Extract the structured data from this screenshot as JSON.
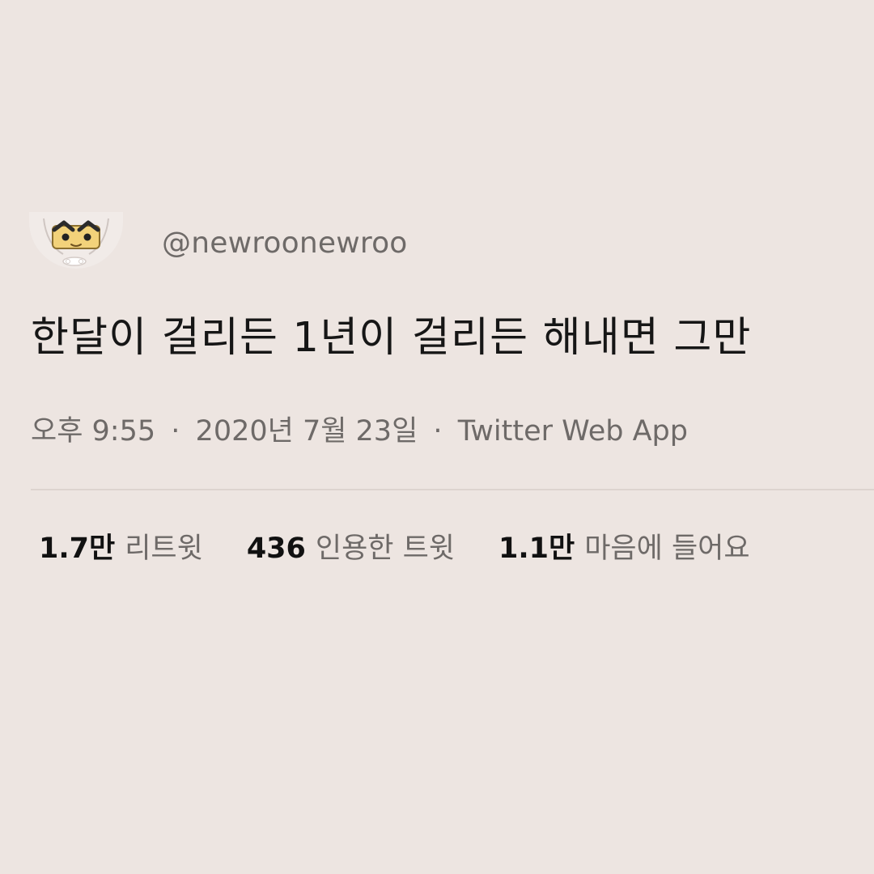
{
  "tweet": {
    "avatar_icon": "cartoon-character-avatar-icon",
    "handle": "@newroonewroo",
    "text": "한달이 걸리든 1년이 걸리든 해내면 그만",
    "time": "오후 9:55",
    "separator": "·",
    "date": "2020년 7월 23일",
    "source": "Twitter Web App",
    "stats": [
      {
        "count": "1.7만",
        "label": "리트윗"
      },
      {
        "count": "436",
        "label": "인용한 트윗"
      },
      {
        "count": "1.1만",
        "label": "마음에 들어요"
      }
    ]
  },
  "colors": {
    "background": "#ede5e1",
    "text_primary": "#161616",
    "text_secondary": "#6e6a68",
    "divider": "#ddd4cf",
    "avatar_face": "#f2d27a"
  }
}
